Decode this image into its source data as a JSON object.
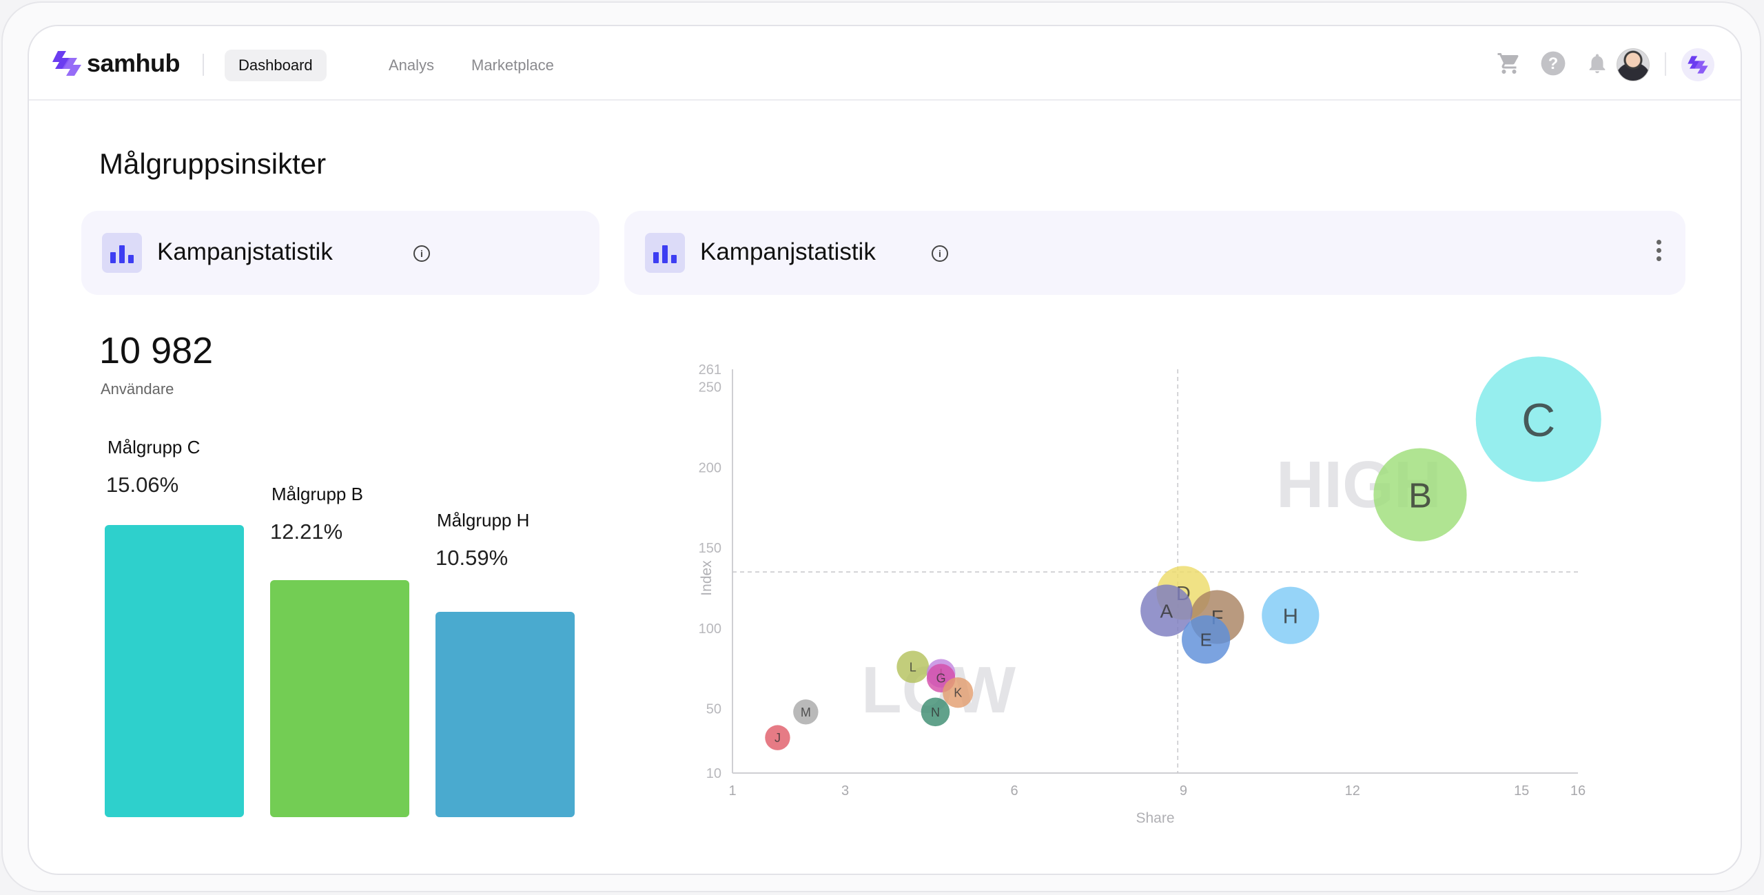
{
  "brand": {
    "name": "samhub"
  },
  "nav": {
    "items": [
      "Dashboard",
      "Analys",
      "Marketplace"
    ],
    "active": "Dashboard"
  },
  "topbar_icons": [
    "cart-icon",
    "help-icon",
    "bell-icon",
    "user-avatar",
    "app-logo-icon"
  ],
  "page": {
    "title": "Målgruppsinsikter"
  },
  "left_card": {
    "title": "Kampanjstatistik",
    "kpi_value": "10 982",
    "kpi_label": "Användare",
    "bars": [
      {
        "label": "Målgrupp C",
        "pct_text": "15.06%",
        "value": 15.06,
        "color": "#2ed0cc"
      },
      {
        "label": "Målgrupp B",
        "pct_text": "12.21%",
        "value": 12.21,
        "color": "#73cd54"
      },
      {
        "label": "Målgrupp H",
        "pct_text": "10.59%",
        "value": 10.59,
        "color": "#4aaacf"
      }
    ]
  },
  "right_card": {
    "title": "Kampanjstatistik"
  },
  "colors": {
    "accent": "#3d3df2",
    "card_bg": "#f6f5fd"
  },
  "chart_data": {
    "type": "scatter",
    "xlabel": "Share",
    "ylabel": "Index",
    "xlim": [
      1,
      16
    ],
    "ylim": [
      10,
      261
    ],
    "x_ticks": [
      1,
      3,
      6,
      9,
      12,
      15,
      16
    ],
    "y_ticks": [
      10,
      50,
      100,
      150,
      200,
      250,
      261
    ],
    "reference_lines": {
      "x": 8.9,
      "y": 135
    },
    "quadrant_labels": [
      "HIGH",
      "LOW"
    ],
    "points": [
      {
        "label": "C",
        "x": 15.3,
        "y": 230,
        "size": 3.5,
        "color": "#7feaea"
      },
      {
        "label": "B",
        "x": 13.2,
        "y": 183,
        "size": 2.6,
        "color": "#9fde7a"
      },
      {
        "label": "H",
        "x": 10.9,
        "y": 108,
        "size": 1.6,
        "color": "#7fcaf7"
      },
      {
        "label": "D",
        "x": 9.0,
        "y": 122,
        "size": 1.5,
        "color": "#eddc6a"
      },
      {
        "label": "F",
        "x": 9.6,
        "y": 107,
        "size": 1.5,
        "color": "#a98463"
      },
      {
        "label": "A",
        "x": 8.7,
        "y": 111,
        "size": 1.45,
        "color": "#7c7cc0"
      },
      {
        "label": "E",
        "x": 9.4,
        "y": 93,
        "size": 1.35,
        "color": "#5e8fd9"
      },
      {
        "label": "L",
        "x": 4.2,
        "y": 76,
        "size": 0.9,
        "color": "#b5c25e"
      },
      {
        "label": "I",
        "x": 4.7,
        "y": 72,
        "size": 0.8,
        "color": "#c287e0"
      },
      {
        "label": "G",
        "x": 4.7,
        "y": 69,
        "size": 0.8,
        "color": "#d44fa9"
      },
      {
        "label": "K",
        "x": 5.0,
        "y": 60,
        "size": 0.85,
        "color": "#e39f70"
      },
      {
        "label": "N",
        "x": 4.6,
        "y": 48,
        "size": 0.8,
        "color": "#3e8d72"
      },
      {
        "label": "M",
        "x": 2.3,
        "y": 48,
        "size": 0.7,
        "color": "#a9a9a9"
      },
      {
        "label": "J",
        "x": 1.8,
        "y": 32,
        "size": 0.7,
        "color": "#e05e6a"
      }
    ]
  }
}
